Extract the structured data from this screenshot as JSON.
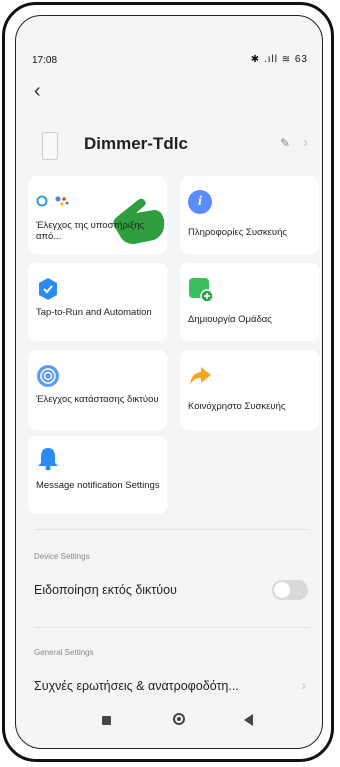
{
  "status_bar": {
    "time": "17:08",
    "indicators": "✱ .ıll ≋ 63"
  },
  "header": {
    "back_icon": "chevron-left-icon",
    "device_name": "Dimmer-Tdlc"
  },
  "cards": [
    {
      "label": "Έλεγχος της υποστήριξης από...",
      "icon": "alexa-google-icon"
    },
    {
      "label": "Πληροφορίες Συσκευής",
      "icon": "info-icon",
      "color": "#5b8cff"
    },
    {
      "label": "Tap-to-Run and Automation",
      "icon": "automation-icon",
      "color": "#2a8cf2"
    },
    {
      "label": "Δημιουργία Ομάδας",
      "icon": "add-group-icon",
      "color": "#3bbf5a"
    },
    {
      "label": "Έλεγχος κατάστασης δικτύου",
      "icon": "network-icon",
      "color": "#5a9cf2"
    },
    {
      "label": "Κοινόχρηστο Συσκευής",
      "icon": "share-icon",
      "color": "#f5a623"
    },
    {
      "label": "Message notification Settings",
      "icon": "bell-icon",
      "color": "#2a8cf2"
    }
  ],
  "device_settings": {
    "title": "Device Settings",
    "offline_notification": "Ειδοποίηση εκτός δικτύου",
    "offline_toggle_on": false
  },
  "general_settings": {
    "title": "General Settings",
    "faq": "Συχνές ερωτήσεις & ανατροφοδότη..."
  }
}
